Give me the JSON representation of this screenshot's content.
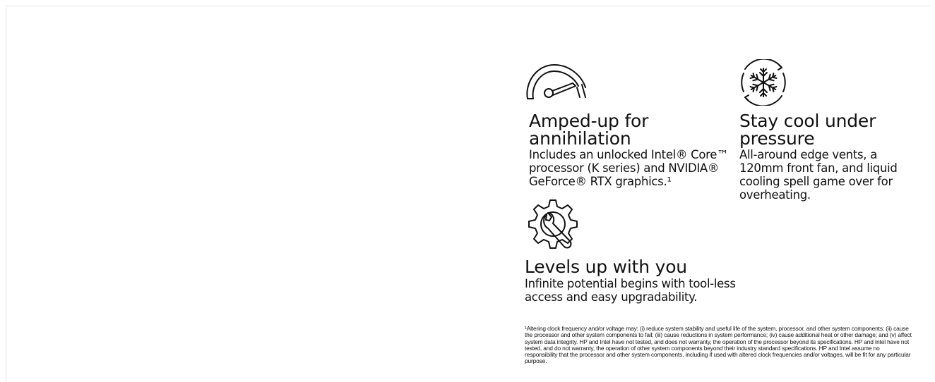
{
  "features": [
    {
      "icon": "speedometer-icon",
      "title": "Amped-up for annihilation",
      "text": "Includes an unlocked Intel® Core™ processor (K series) and NVIDIA® GeForce® RTX graphics.¹"
    },
    {
      "icon": "snowflake-icon",
      "title": "Stay cool under pressure",
      "text": "All-around edge vents, a 120mm front fan, and liquid cooling spell game over for overheating."
    },
    {
      "icon": "gear-wrench-icon",
      "title": "Levels up with you",
      "text": "Infinite potential begins with tool-less access and easy upgradability."
    }
  ],
  "footnote": "¹Altering clock frequency and/or voltage may: (i) reduce system stability and useful life of the system, processor, and other system components; (ii) cause the processor and other system components to fail; (iii) cause reductions in system performance; (iv) cause additional heat or other damage; and (v) affect system data integrity. HP and Intel have not tested, and does not warranty, the operation of the processor beyond its specifications. HP and Intel have not tested, and do not warranty, the operation of other system components beyond their industry standard specifications. HP and Intel assume no responsibility that the processor and other system components, including if used with altered clock frequencies and/or voltages, will be fit for any particular purpose."
}
